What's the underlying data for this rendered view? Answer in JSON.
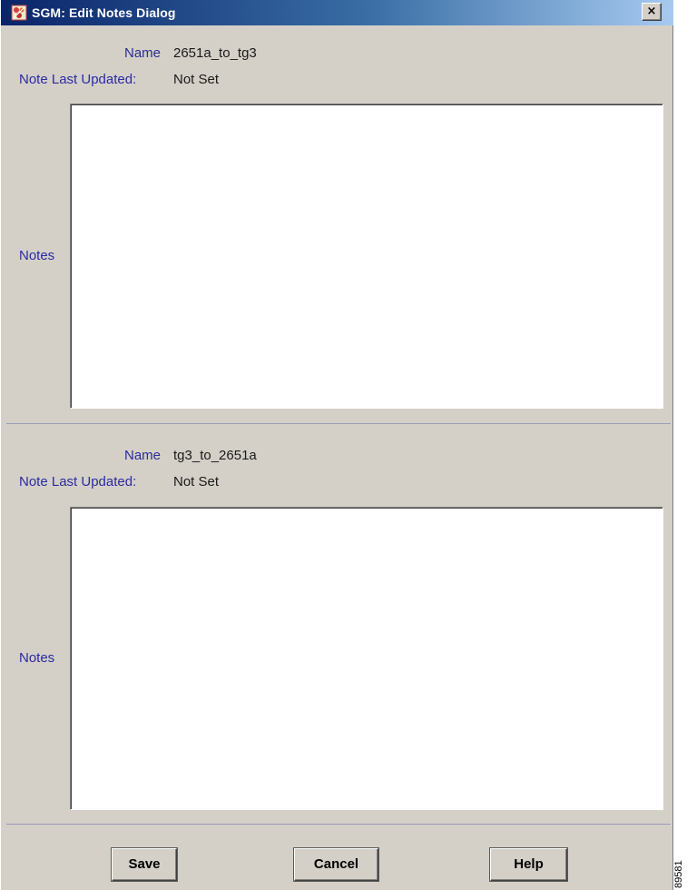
{
  "window": {
    "title": "SGM: Edit Notes Dialog",
    "close_label": "×",
    "app_icon": "sgm-app-icon",
    "close_icon": "close-icon"
  },
  "sections": [
    {
      "name_label": "Name",
      "name_value": "2651a_to_tg3",
      "updated_label": "Note Last Updated:",
      "updated_value": "Not Set",
      "notes_label": "Notes",
      "notes_value": ""
    },
    {
      "name_label": "Name",
      "name_value": "tg3_to_2651a",
      "updated_label": "Note Last Updated:",
      "updated_value": "Not Set",
      "notes_label": "Notes",
      "notes_value": ""
    }
  ],
  "buttons": {
    "save": "Save",
    "cancel": "Cancel",
    "help": "Help"
  },
  "figure_id": "89581",
  "colors": {
    "window_bg": "#d4d0c8",
    "title_gradient_start": "#0a246a",
    "title_gradient_end": "#a6caf0",
    "label_text": "#2b2b9e"
  }
}
